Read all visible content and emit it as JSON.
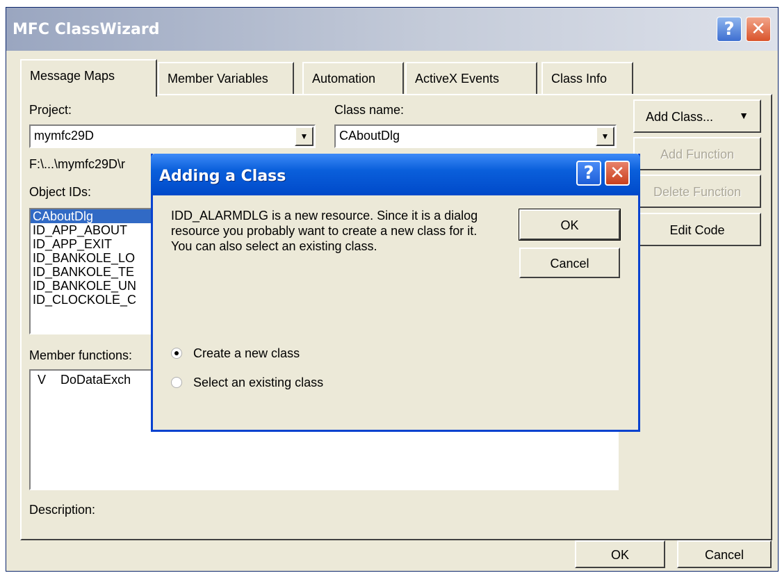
{
  "window": {
    "title": "MFC ClassWizard",
    "help_glyph": "?",
    "close_glyph": "✕"
  },
  "tabs": [
    {
      "label": "Message Maps",
      "active": true
    },
    {
      "label": "Member Variables",
      "active": false
    },
    {
      "label": "Automation",
      "active": false
    },
    {
      "label": "ActiveX Events",
      "active": false
    },
    {
      "label": "Class Info",
      "active": false
    }
  ],
  "project": {
    "label": "Project:",
    "value": "mymfc29D",
    "path": "F:\\...\\mymfc29D\\r"
  },
  "class_name": {
    "label": "Class name:",
    "value": "CAboutDlg"
  },
  "object_ids": {
    "label": "Object IDs:",
    "items": [
      "CAboutDlg",
      "ID_APP_ABOUT",
      "ID_APP_EXIT",
      "ID_BANKOLE_LO",
      "ID_BANKOLE_TE",
      "ID_BANKOLE_UN",
      "ID_CLOCKOLE_C"
    ],
    "selected_index": 0
  },
  "member_functions": {
    "label": "Member functions:",
    "items": [
      {
        "marker": "V",
        "name": "DoDataExch"
      }
    ]
  },
  "description_label": "Description:",
  "side_buttons": {
    "add_class": "Add Class...",
    "add_class_arrow": "▼",
    "add_function": "Add Function",
    "delete_function": "Delete Function",
    "edit_code": "Edit Code"
  },
  "footer_buttons": {
    "ok": "OK",
    "cancel": "Cancel"
  },
  "dialog": {
    "title": "Adding a Class",
    "message": "IDD_ALARMDLG is a new resource.  Since it is a dialog resource you probably want to create a new class for it.  You can also select an existing class.",
    "ok": "OK",
    "cancel": "Cancel",
    "options": [
      {
        "label": "Create a new class",
        "checked": true
      },
      {
        "label": "Select an existing class",
        "checked": false
      }
    ]
  }
}
